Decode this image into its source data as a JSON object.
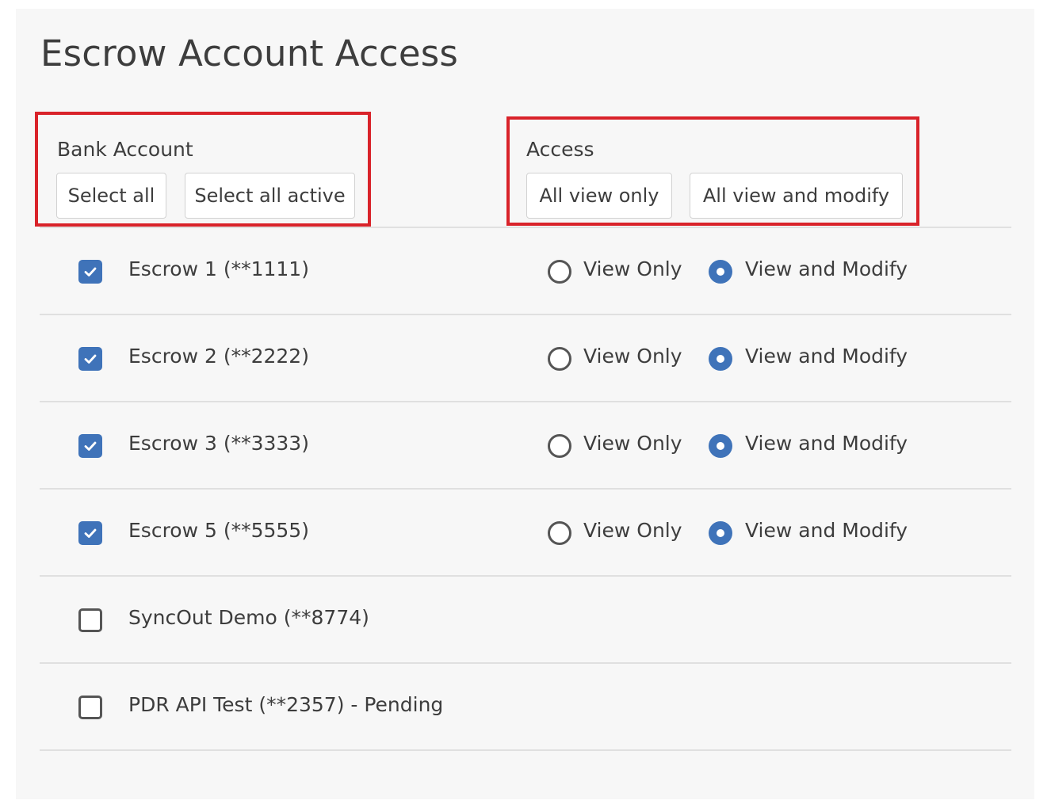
{
  "page": {
    "title": "Escrow Account Access"
  },
  "bank_account": {
    "label": "Bank Account",
    "select_all_label": "Select all",
    "select_all_active_label": "Select all active"
  },
  "access": {
    "label": "Access",
    "all_view_only_label": "All view only",
    "all_view_modify_label": "All view and modify"
  },
  "options": {
    "view_only": "View Only",
    "view_modify": "View and Modify"
  },
  "accounts": [
    {
      "name": "Escrow 1 (**1111)",
      "checked": true,
      "access": "view_modify"
    },
    {
      "name": "Escrow 2 (**2222)",
      "checked": true,
      "access": "view_modify"
    },
    {
      "name": "Escrow 3 (**3333)",
      "checked": true,
      "access": "view_modify"
    },
    {
      "name": "Escrow 5 (**5555)",
      "checked": true,
      "access": "view_modify"
    },
    {
      "name": "SyncOut Demo (**8774)",
      "checked": false,
      "access": ""
    },
    {
      "name": "PDR API Test (**2357) - Pending",
      "checked": false,
      "access": ""
    }
  ],
  "colors": {
    "accent": "#3f73b9",
    "highlight": "#d9232a",
    "text": "#3d3d3d",
    "panel_background": "#f7f7f7"
  }
}
